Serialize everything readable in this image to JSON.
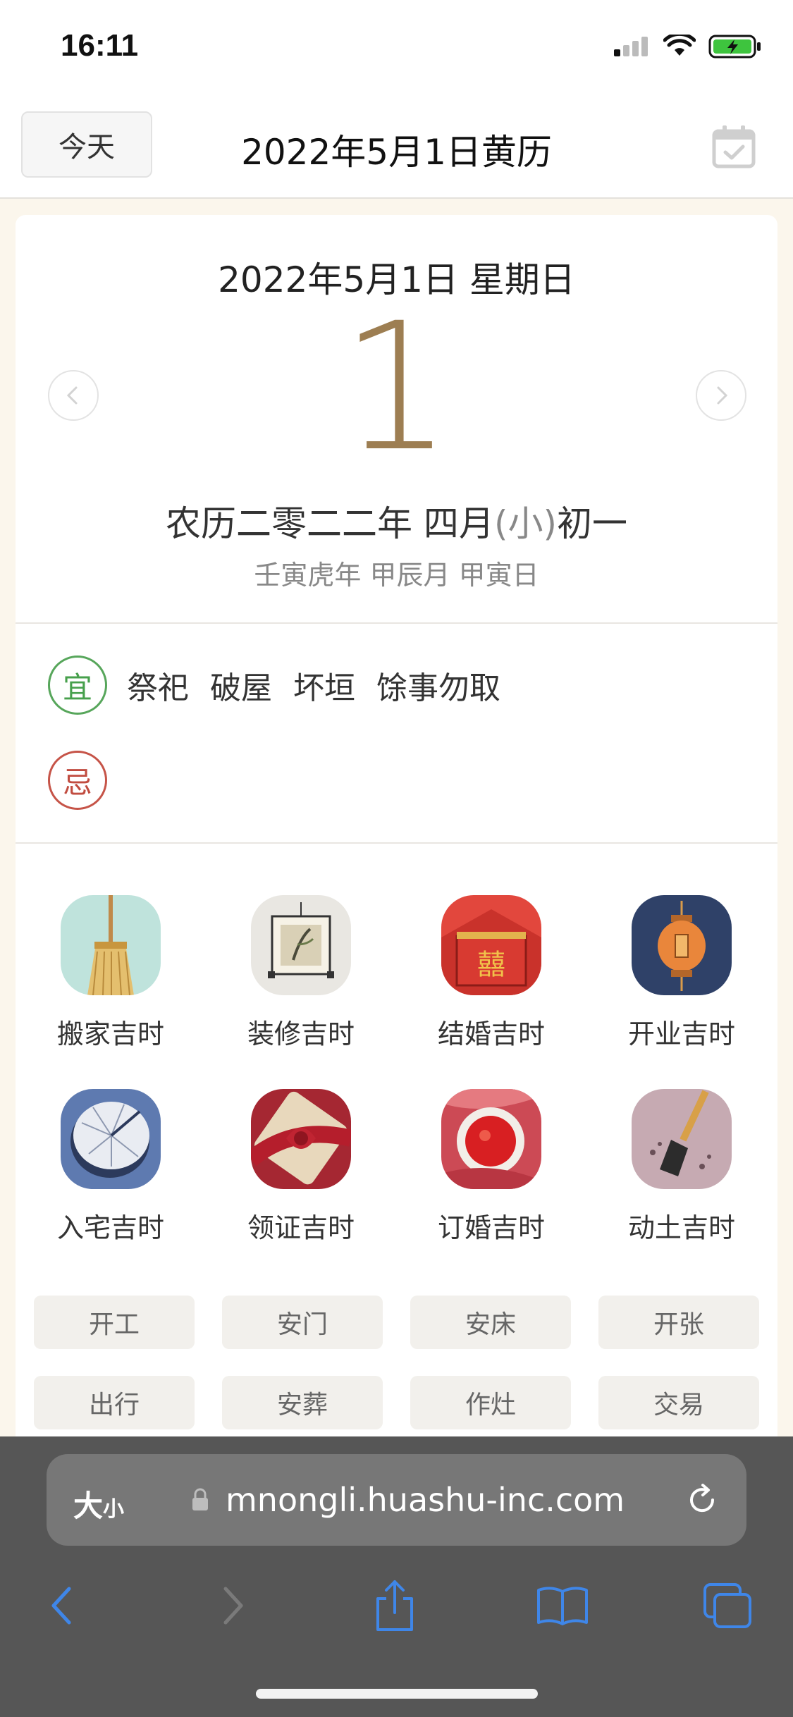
{
  "status_bar": {
    "time": "16:11"
  },
  "header": {
    "today_label": "今天",
    "title": "2022年5月1日黄历"
  },
  "day": {
    "date_line": "2022年5月1日 星期日",
    "day_number": "1",
    "lunar_prefix": "农历二零二二年 四月",
    "lunar_size": "(小)",
    "lunar_day": "初一",
    "ganzhi": "壬寅虎年 甲辰月 甲寅日"
  },
  "yi_ji": {
    "yi_label": "宜",
    "yi_items": [
      "祭祀",
      "破屋",
      "坏垣",
      "馀事勿取"
    ],
    "ji_label": "忌"
  },
  "auspicious_times": [
    {
      "label": "搬家吉时",
      "icon": "broom-icon"
    },
    {
      "label": "装修吉时",
      "icon": "scroll-painting-icon"
    },
    {
      "label": "结婚吉时",
      "icon": "double-happiness-icon"
    },
    {
      "label": "开业吉时",
      "icon": "lantern-icon"
    },
    {
      "label": "入宅吉时",
      "icon": "sundial-icon"
    },
    {
      "label": "领证吉时",
      "icon": "certificate-ribbon-icon"
    },
    {
      "label": "订婚吉时",
      "icon": "tea-cup-icon"
    },
    {
      "label": "动土吉时",
      "icon": "shovel-icon"
    }
  ],
  "activity_tags": [
    "开工",
    "安门",
    "安床",
    "开张",
    "出行",
    "安葬",
    "作灶",
    "交易"
  ],
  "browser": {
    "text_size_big": "大",
    "text_size_small": "小",
    "url": "mnongli.huashu-inc.com"
  },
  "colors": {
    "accent_gold": "#9d7e52",
    "yi_green": "#47a04c",
    "ji_red": "#c14c40",
    "safari_blue": "#3f86e8"
  }
}
